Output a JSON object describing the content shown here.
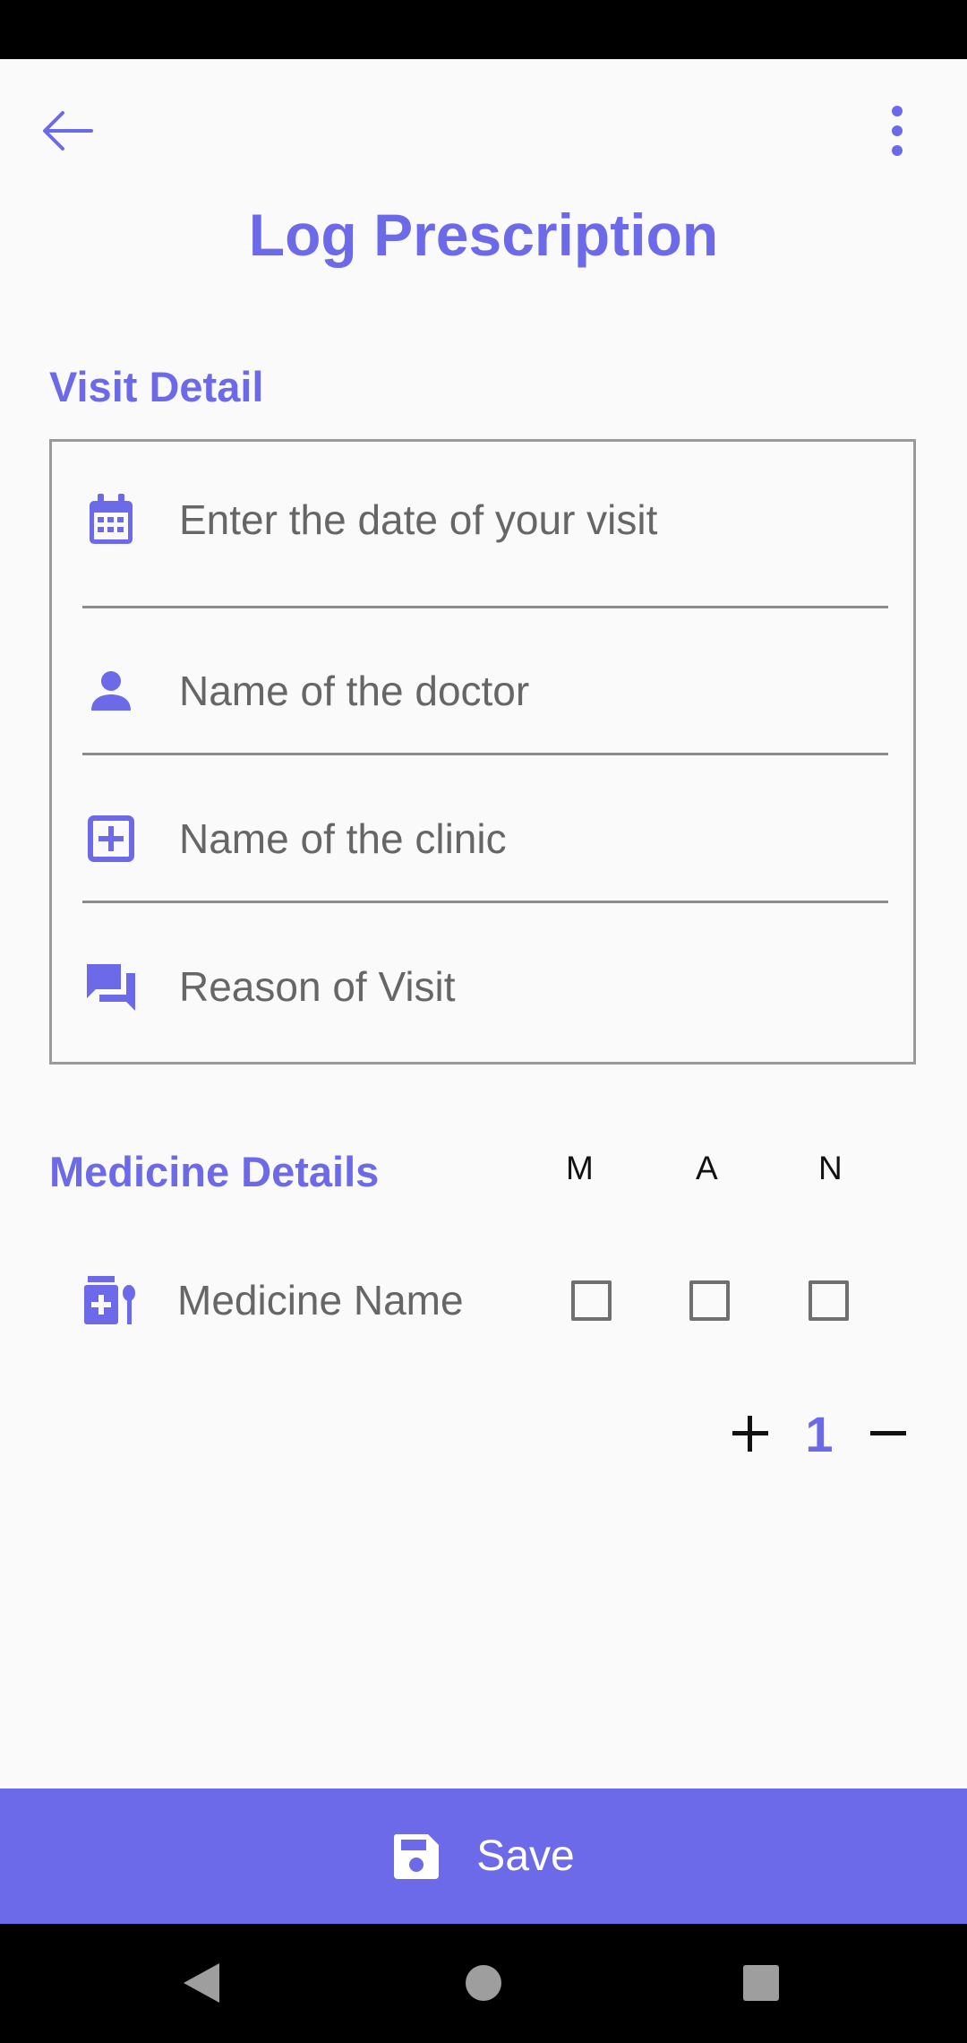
{
  "app": {
    "title": "Log Prescription",
    "accent_color": "#6c6ae8"
  },
  "toolbar": {
    "back_icon": "arrow-back-icon",
    "more_icon": "more-vert-icon"
  },
  "visit_detail": {
    "section_title": "Visit Detail",
    "fields": [
      {
        "icon": "calendar-icon",
        "placeholder": "Enter the date of your visit"
      },
      {
        "icon": "person-icon",
        "placeholder": "Name of the doctor"
      },
      {
        "icon": "medical-plus-icon",
        "placeholder": "Name of the clinic"
      },
      {
        "icon": "chat-icon",
        "placeholder": "Reason of Visit"
      }
    ]
  },
  "medicine_details": {
    "section_title": "Medicine Details",
    "columns": [
      "M",
      "A",
      "N"
    ],
    "row": {
      "icon": "medicine-icon",
      "placeholder": "Medicine Name",
      "checked": [
        false,
        false,
        false
      ]
    },
    "quantity": "1",
    "increment_icon": "plus-icon",
    "decrement_icon": "minus-icon"
  },
  "save_button": {
    "label": "Save",
    "icon": "save-icon"
  },
  "system_nav": [
    "back-triangle-icon",
    "home-circle-icon",
    "recents-square-icon"
  ]
}
